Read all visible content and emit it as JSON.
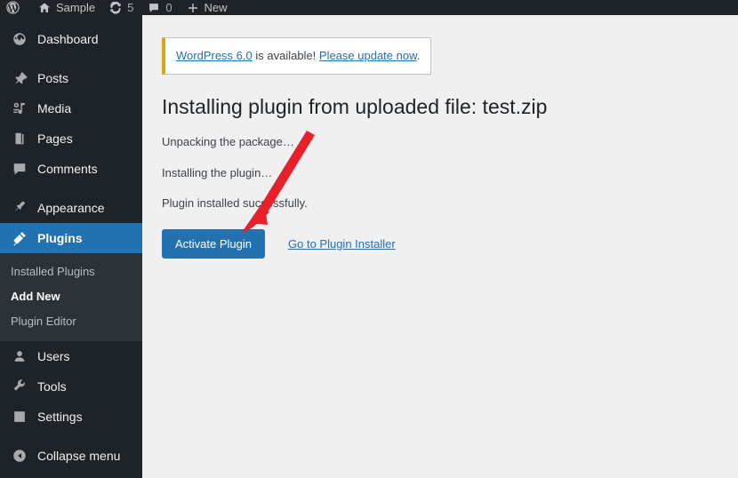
{
  "adminbar": {
    "logo_icon": "wordpress-logo-icon",
    "items": [
      {
        "icon": "home-icon",
        "label": "Sample",
        "name": "adminbar-site-name"
      },
      {
        "icon": "updates-icon",
        "label": "5",
        "name": "adminbar-updates"
      },
      {
        "icon": "comment-icon",
        "label": "0",
        "name": "adminbar-comments"
      },
      {
        "icon": "plus-icon",
        "label": "New",
        "name": "adminbar-new-content"
      }
    ]
  },
  "sidebar": {
    "items": [
      {
        "label": "Dashboard",
        "icon": "dashboard-icon",
        "name": "sidebar-item-dashboard",
        "current": false,
        "sep_after": true
      },
      {
        "label": "Posts",
        "icon": "pin-icon",
        "name": "sidebar-item-posts",
        "current": false,
        "sep_after": false
      },
      {
        "label": "Media",
        "icon": "media-icon",
        "name": "sidebar-item-media",
        "current": false,
        "sep_after": false
      },
      {
        "label": "Pages",
        "icon": "pages-icon",
        "name": "sidebar-item-pages",
        "current": false,
        "sep_after": false
      },
      {
        "label": "Comments",
        "icon": "comment-icon",
        "name": "sidebar-item-comments",
        "current": false,
        "sep_after": true
      },
      {
        "label": "Appearance",
        "icon": "appearance-icon",
        "name": "sidebar-item-appearance",
        "current": false,
        "sep_after": false
      },
      {
        "label": "Plugins",
        "icon": "plugins-icon",
        "name": "sidebar-item-plugins",
        "current": true,
        "sep_after": false
      }
    ],
    "submenu": {
      "parent": "Plugins",
      "items": [
        {
          "label": "Installed Plugins",
          "name": "submenu-item-installed-plugins",
          "current": false
        },
        {
          "label": "Add New",
          "name": "submenu-item-add-new",
          "current": true
        },
        {
          "label": "Plugin Editor",
          "name": "submenu-item-plugin-editor",
          "current": false
        }
      ]
    },
    "items_bottom": [
      {
        "label": "Users",
        "icon": "user-icon",
        "name": "sidebar-item-users"
      },
      {
        "label": "Tools",
        "icon": "wrench-icon",
        "name": "sidebar-item-tools"
      },
      {
        "label": "Settings",
        "icon": "settings-icon",
        "name": "sidebar-item-settings"
      }
    ],
    "collapse": {
      "label": "Collapse menu",
      "icon": "collapse-arrow-icon",
      "name": "sidebar-collapse-menu"
    },
    "colors": {
      "background": "#1d2327",
      "submenu_background": "#2c3338",
      "current_background": "#2271b1",
      "text": "#f0f0f1"
    }
  },
  "notice": {
    "link_version": "WordPress 6.0",
    "middle_text": " is available! ",
    "link_update": "Please update now",
    "end_text": ".",
    "accent_color": "#dba617"
  },
  "page": {
    "title": "Installing plugin from uploaded file: test.zip",
    "status_lines": [
      "Unpacking the package…",
      "Installing the plugin…",
      "Plugin installed successfully."
    ]
  },
  "actions": {
    "activate_label": "Activate Plugin",
    "installer_link_label": "Go to Plugin Installer",
    "primary_color": "#2271b1"
  },
  "annotation": {
    "type": "arrow",
    "color": "#e8202a",
    "points_to": "activate-plugin-button"
  }
}
